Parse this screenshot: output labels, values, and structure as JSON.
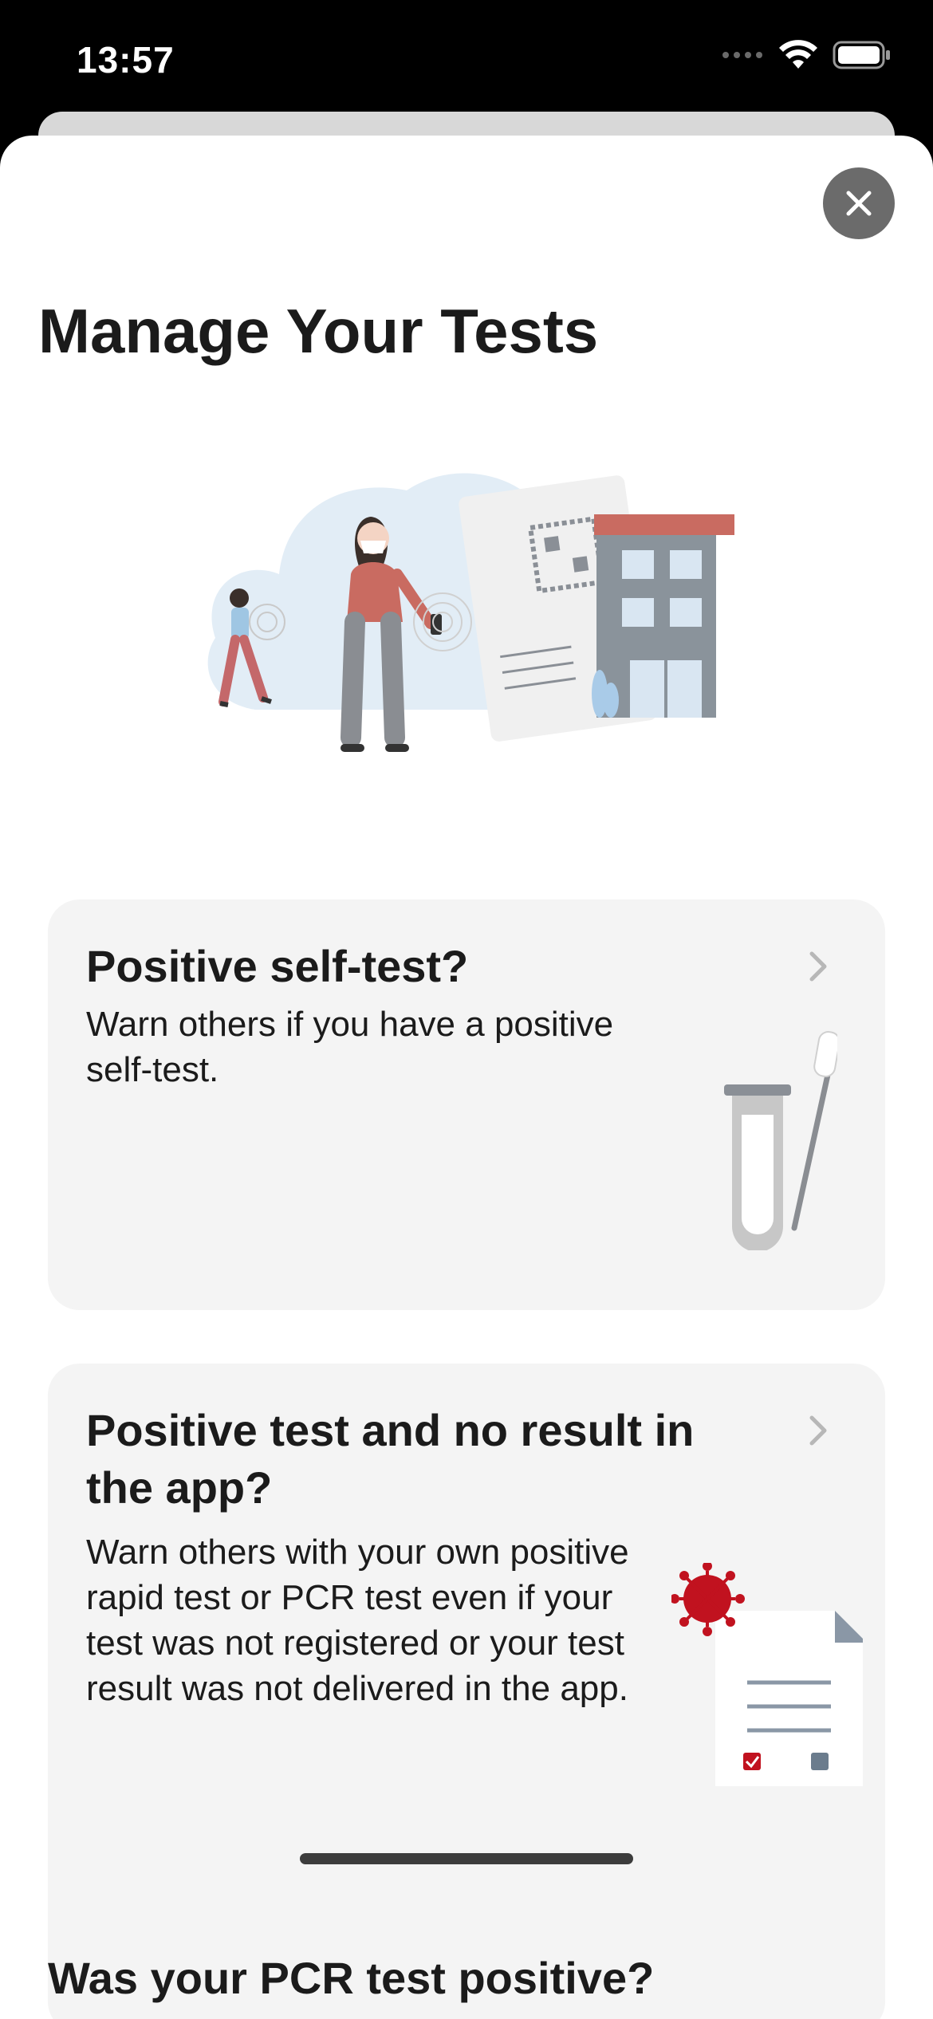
{
  "status_bar": {
    "time": "13:57"
  },
  "header": {
    "title": "Manage Your Tests"
  },
  "cards": [
    {
      "title": "Positive self-test?",
      "body": "Warn others if you have a positive self-test."
    },
    {
      "title": "Positive test and no result in the app?",
      "body": "Warn others with your own positive rapid test or PCR test even if your test was not registered or your test result was not delivered in the app."
    }
  ],
  "section": {
    "heading": "Was your PCR test positive?"
  },
  "icons": [
    "close-icon",
    "chevron-right-icon",
    "wifi-icon",
    "battery-icon",
    "cellular-icon",
    "test-tube-icon",
    "document-virus-icon"
  ],
  "colors": {
    "accent_red": "#c1121f",
    "card_bg": "#f4f4f4",
    "close_bg": "#6b6b6b"
  }
}
